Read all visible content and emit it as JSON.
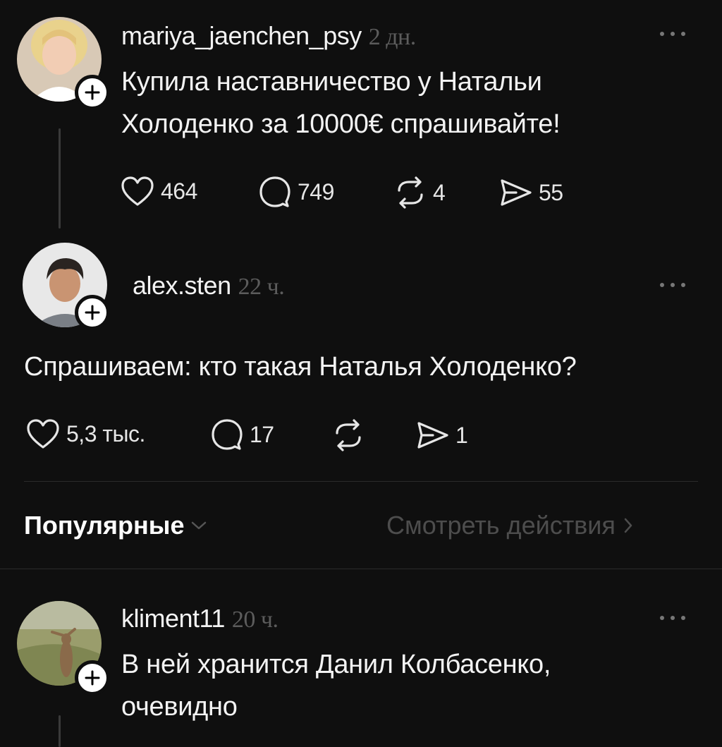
{
  "posts": [
    {
      "username": "mariya_jaenchen_psy",
      "time": "2 дн.",
      "text_lines": [
        "Купила наставничество у Натальи",
        "Холоденко за 10000€ спрашивайте!"
      ],
      "likes": "464",
      "comments": "749",
      "reposts": "4",
      "shares": "55"
    },
    {
      "username": "alex.sten",
      "time": "22 ч.",
      "text_lines": [
        "Спрашиваем: кто такая Наталья Холоденко?"
      ],
      "likes": "5,3 тыс.",
      "comments": "17",
      "reposts": "",
      "shares": "1"
    },
    {
      "username": "kliment11",
      "time": "20 ч.",
      "text_lines": [
        "В ней хранится Данил Колбасенко,",
        "очевидно"
      ]
    }
  ],
  "replies_bar": {
    "sort_label": "Популярные",
    "view_activity_label": "Смотреть действия"
  },
  "icons": {
    "like": "heart-icon",
    "comment": "comment-icon",
    "repost": "repost-icon",
    "share": "send-icon",
    "more": "more-icon",
    "follow": "plus-icon",
    "chevron_down": "chevron-down-icon",
    "chevron_right": "chevron-right-icon"
  },
  "colors": {
    "background": "#0f0f0f",
    "text": "#f3f3f3",
    "muted": "#5c5c5c",
    "divider": "#2a2a2a"
  }
}
